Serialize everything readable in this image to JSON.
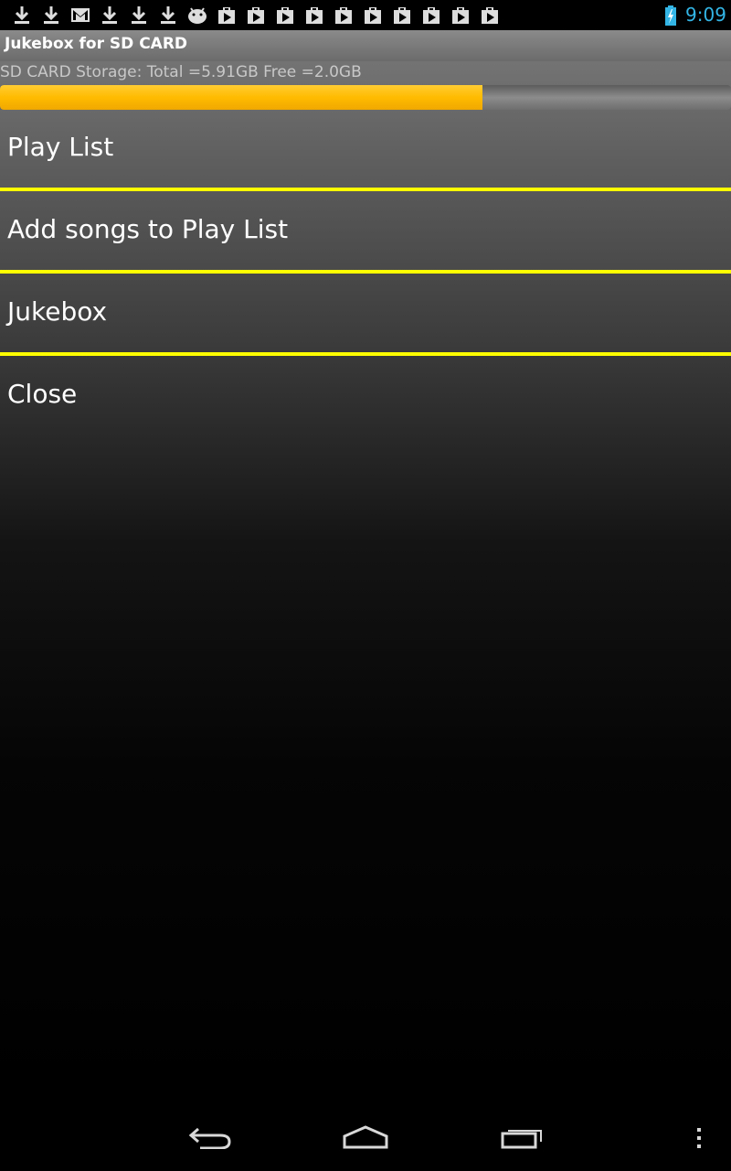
{
  "status_bar": {
    "time": "9:09",
    "clock_color": "#33b5e5",
    "notification_icons": [
      "download-icon",
      "download-icon",
      "gmail-icon",
      "download-icon",
      "download-icon",
      "download-icon",
      "android-icon",
      "play-store-icon",
      "play-store-icon",
      "play-store-icon",
      "play-store-icon",
      "play-store-icon",
      "play-store-icon",
      "play-store-icon",
      "play-store-icon",
      "play-store-icon",
      "play-store-icon"
    ],
    "battery_icon": "battery-charging-icon"
  },
  "app": {
    "title": "Jukebox for SD CARD",
    "storage_text": "SD CARD Storage: Total =5.91GB Free =2.0GB",
    "storage_used_fraction": 0.66,
    "progress_color": "#ffbb00",
    "divider_color": "#ffff00"
  },
  "menu": {
    "items": [
      {
        "label": "Play List"
      },
      {
        "label": "Add songs to Play List"
      },
      {
        "label": "Jukebox"
      },
      {
        "label": "Close"
      }
    ]
  },
  "nav_bar": {
    "buttons": [
      "back-icon",
      "home-icon",
      "recent-apps-icon",
      "overflow-menu-icon"
    ]
  }
}
